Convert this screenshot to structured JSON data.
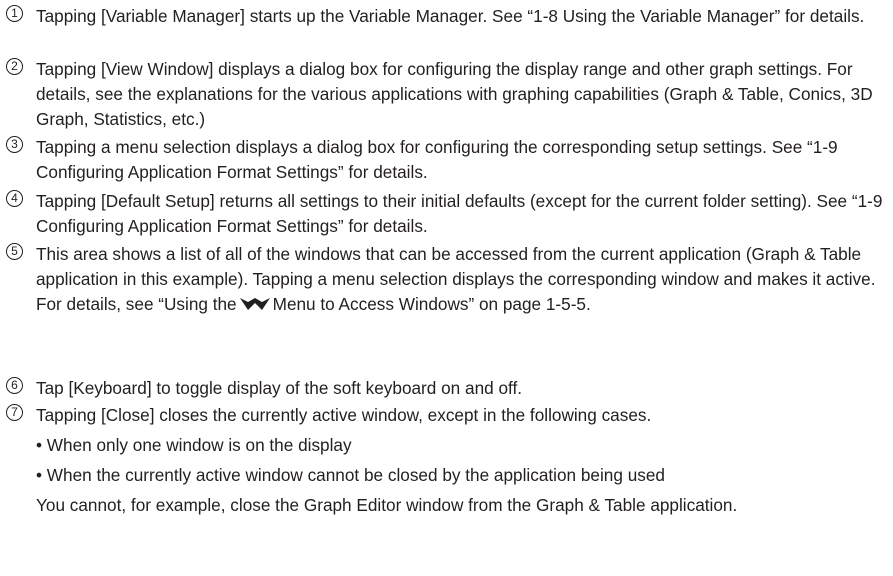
{
  "items": [
    {
      "number": "1",
      "text": "Tapping [Variable Manager] starts up the Variable Manager. See “1-8 Using the Variable Manager” for details."
    },
    {
      "number": "2",
      "text": "Tapping [View Window] displays a dialog box for configuring the display range and other graph settings. For details, see the explanations for the various applications with graphing capabilities (Graph & Table, Conics, 3D Graph, Statistics, etc.)"
    },
    {
      "number": "3",
      "text": "Tapping a menu selection displays a dialog box for configuring the corresponding setup settings. See “1-9 Configuring Application Format Settings” for details."
    },
    {
      "number": "4",
      "text": "Tapping [Default Setup] returns all settings to their initial defaults (except for the current folder setting). See “1-9 Configuring Application Format Settings” for details."
    },
    {
      "number": "5",
      "text_before": "This area shows a list of all of the windows that can be accessed from the current application (Graph & Table application in this example). Tapping a menu selection displays the corresponding window and makes it active. For details, see “Using the",
      "icon": "window-menu-icon",
      "text_after": "Menu to Access Windows” on page 1-5-5."
    },
    {
      "number": "6",
      "text": "Tap [Keyboard] to toggle display of the soft keyboard on and off."
    },
    {
      "number": "7",
      "text": "Tapping [Close] closes the currently active window, except in the following cases."
    }
  ],
  "bullets": [
    "• When only one window is on the display",
    "• When the currently active window cannot be closed by the application being used"
  ],
  "note": "You cannot, for example, close the Graph Editor window from the Graph & Table application."
}
